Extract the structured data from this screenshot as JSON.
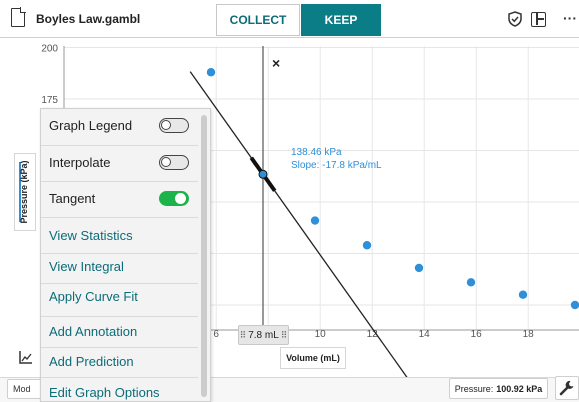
{
  "file": {
    "name": "Boyles Law.gambl",
    "icon": "file-icon"
  },
  "tabs": {
    "collect": "COLLECT",
    "keep": "KEEP"
  },
  "header_icons": [
    "shield-check-icon",
    "layout-icon",
    "more-icon"
  ],
  "more_glyph": "···",
  "graph": {
    "y_ticks": [
      "200",
      "175"
    ],
    "x_ticks": [
      "6",
      "10",
      "12",
      "14",
      "16",
      "18"
    ],
    "y_axis_label": "Pressure (kPa)",
    "x_axis_label": "Volume (mL)",
    "close_glyph": "×",
    "cursor_value": "7.8 mL",
    "tangent": {
      "pressure": "138.46 kPa",
      "slope": "Slope: -17.8 kPa/mL"
    },
    "point_color": "#2f8fd8"
  },
  "chart_data": {
    "type": "scatter",
    "xlabel": "Volume (mL)",
    "ylabel": "Pressure (kPa)",
    "series": [
      {
        "x": [
          5.8,
          7.8,
          9.8,
          11.8,
          13.8,
          15.8,
          17.8,
          19.8
        ],
        "y": [
          188,
          138.5,
          116,
          104,
          93,
          86,
          80,
          75
        ]
      }
    ],
    "tangent": {
      "x": 7.8,
      "y": 138.46,
      "slope": -17.8
    },
    "cursor_x": 7.8
  },
  "menu": {
    "items": [
      {
        "label": "Graph Legend",
        "type": "toggle",
        "on": false
      },
      {
        "label": "Interpolate",
        "type": "toggle",
        "on": false
      },
      {
        "label": "Tangent",
        "type": "toggle",
        "on": true
      },
      {
        "label": "View Statistics",
        "type": "link"
      },
      {
        "label": "View Integral",
        "type": "link"
      },
      {
        "label": "Apply Curve Fit",
        "type": "link"
      },
      {
        "label": "Add Annotation",
        "type": "link"
      },
      {
        "label": "Add Prediction",
        "type": "link"
      },
      {
        "label": "Edit Graph Options",
        "type": "link"
      }
    ]
  },
  "bottom": {
    "mode_label": "Mod",
    "pressure_label": "Pressure:",
    "pressure_value": "100.92 kPa"
  },
  "colors": {
    "accent": "#0b7d86",
    "toggle_on": "#1db34b",
    "data": "#2f8fd8"
  }
}
